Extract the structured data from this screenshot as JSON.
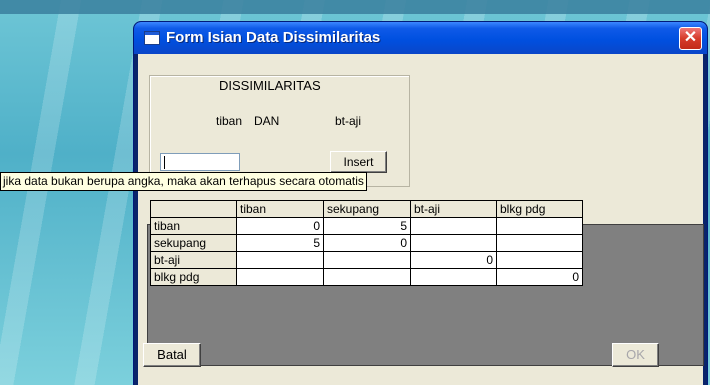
{
  "window": {
    "title": "Form Isian Data Dissimilaritas",
    "close_label": "✕"
  },
  "group": {
    "title": "DISSIMILARITAS",
    "item_a": "tiban",
    "connector": "DAN",
    "item_b": "bt-aji"
  },
  "input": {
    "value": ""
  },
  "buttons": {
    "insert": "Insert",
    "batal": "Batal",
    "ok": "OK"
  },
  "tooltip": "jika data bukan berupa angka, maka akan terhapus secara otomatis",
  "grid": {
    "columns": [
      "tiban",
      "sekupang",
      "bt-aji",
      "blkg pdg"
    ],
    "rows": [
      {
        "label": "tiban",
        "cells": [
          "0",
          "5",
          "",
          ""
        ]
      },
      {
        "label": "sekupang",
        "cells": [
          "5",
          "0",
          "",
          ""
        ]
      },
      {
        "label": "bt-aji",
        "cells": [
          "",
          "",
          "0",
          ""
        ]
      },
      {
        "label": "blkg pdg",
        "cells": [
          "",
          "",
          "",
          "0"
        ]
      }
    ]
  },
  "colors": {
    "titlebar": "#0050e0",
    "close": "#d63b2a",
    "tooltip_bg": "#ffffe1",
    "face": "#ece9d8"
  }
}
